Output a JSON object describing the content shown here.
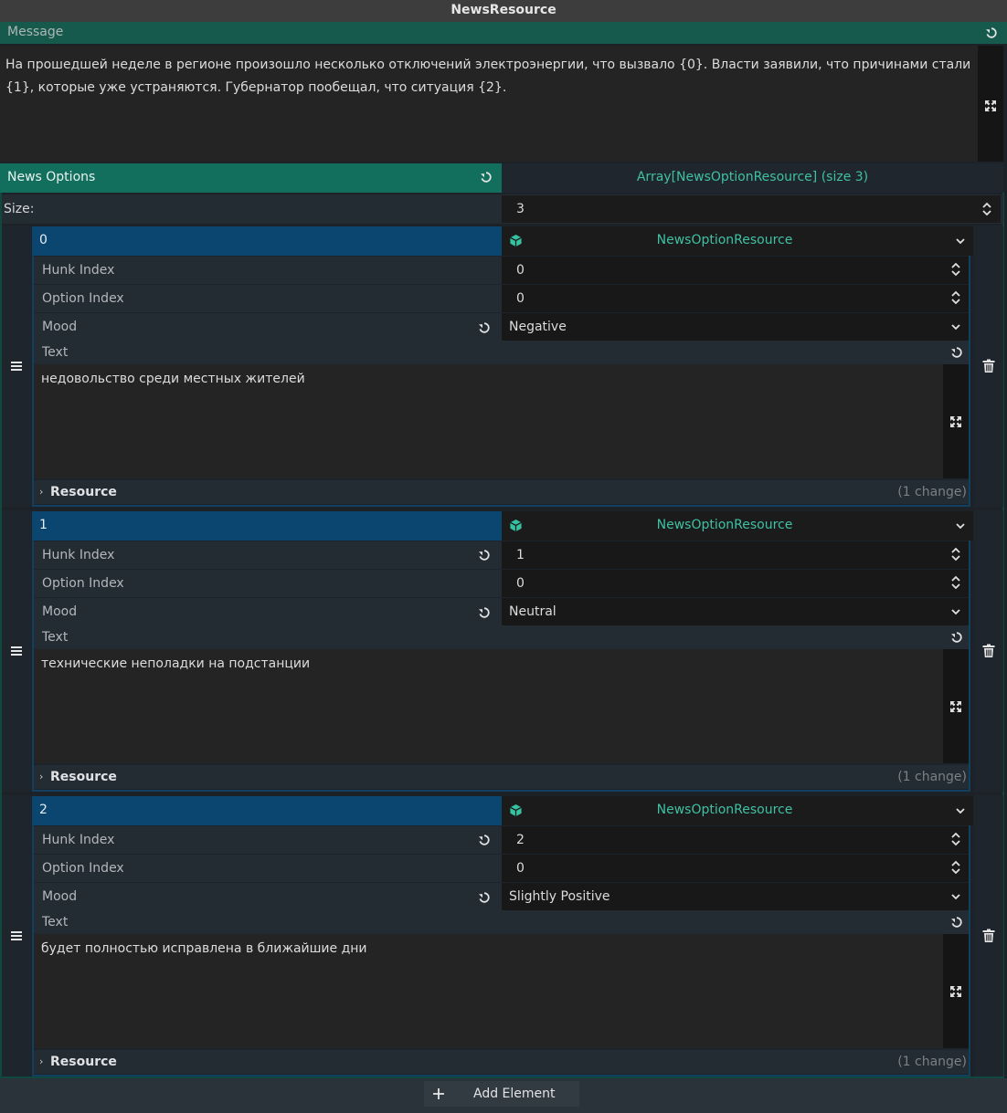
{
  "window": {
    "title": "NewsResource"
  },
  "message": {
    "label": "Message",
    "text": "На прошедшей неделе в регионе произошло несколько отключений электроэнергии, что вызвало {0}. Власти заявили, что причинами стали {1}, которые уже устраняются. Губернатор пообещал, что ситуация {2}."
  },
  "news_options": {
    "label": "News Options",
    "type_label": "Array[NewsOptionResource] (size 3)",
    "size_label": "Size:",
    "size_value": "3",
    "field_labels": {
      "hunk_index": "Hunk Index",
      "option_index": "Option Index",
      "mood": "Mood",
      "text": "Text",
      "resource": "Resource"
    },
    "elements": [
      {
        "index": "0",
        "resource_type": "NewsOptionResource",
        "hunk_index": "0",
        "option_index": "0",
        "mood": "Negative",
        "text": "недовольство среди местных жителей",
        "changes": "(1 change)"
      },
      {
        "index": "1",
        "resource_type": "NewsOptionResource",
        "hunk_index": "1",
        "option_index": "0",
        "mood": "Neutral",
        "text": "технические неполадки на подстанции",
        "changes": "(1 change)"
      },
      {
        "index": "2",
        "resource_type": "NewsOptionResource",
        "hunk_index": "2",
        "option_index": "0",
        "mood": "Slightly Positive",
        "text": "будет полностью исправлена в ближайшие дни",
        "changes": "(1 change)"
      }
    ],
    "add_label": "Add Element"
  },
  "colors": {
    "accent": "#126f5e",
    "type_text": "#3fc1a4",
    "index_bar": "#0b4670",
    "panel": "#1d2229"
  },
  "icons": [
    "reset-icon",
    "expand-icon",
    "spinner-icon",
    "chevron-down-icon",
    "cube-icon",
    "drag-handle-icon",
    "trash-icon",
    "chevron-right-icon",
    "plus-icon"
  ]
}
